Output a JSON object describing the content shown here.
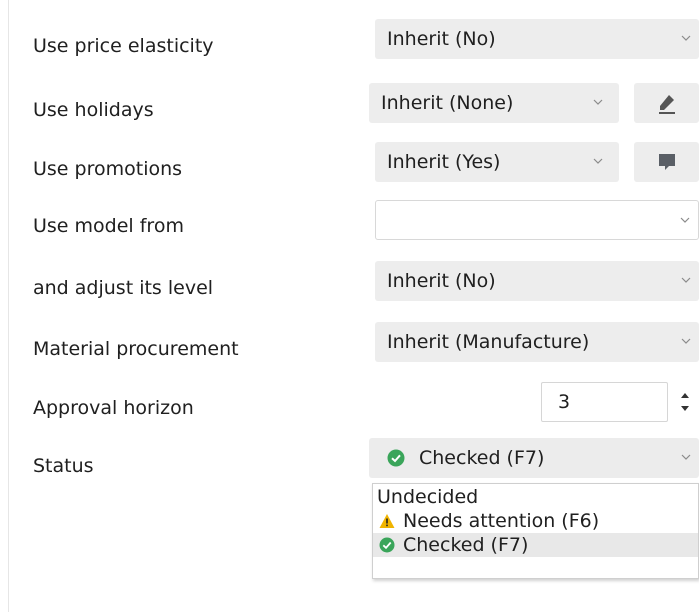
{
  "rows": [
    {
      "label": "Use price elasticity",
      "value": "Inherit (No)"
    },
    {
      "label": "Use holidays",
      "value": "Inherit (None)"
    },
    {
      "label": "Use promotions",
      "value": "Inherit (Yes)"
    },
    {
      "label": "Use model from",
      "value": ""
    },
    {
      "label": "and adjust its level",
      "value": "Inherit (No)"
    },
    {
      "label": "Material procurement",
      "value": "Inherit (Manufacture)"
    },
    {
      "label": "Approval horizon",
      "value": "3"
    },
    {
      "label": "Status",
      "value": "Checked (F7)"
    }
  ],
  "status_options": [
    {
      "label": "Undecided",
      "icon": ""
    },
    {
      "label": "Needs attention (F6)",
      "icon": "warning-icon"
    },
    {
      "label": "Checked (F7)",
      "icon": "check-circle-icon"
    }
  ],
  "side_buttons": {
    "holidays": "edit-pencil-icon",
    "promotions": "comment-icon"
  },
  "colors": {
    "control_bg": "#ededed",
    "check_green": "#3aa55a",
    "warning_yellow": "#f0b400"
  }
}
